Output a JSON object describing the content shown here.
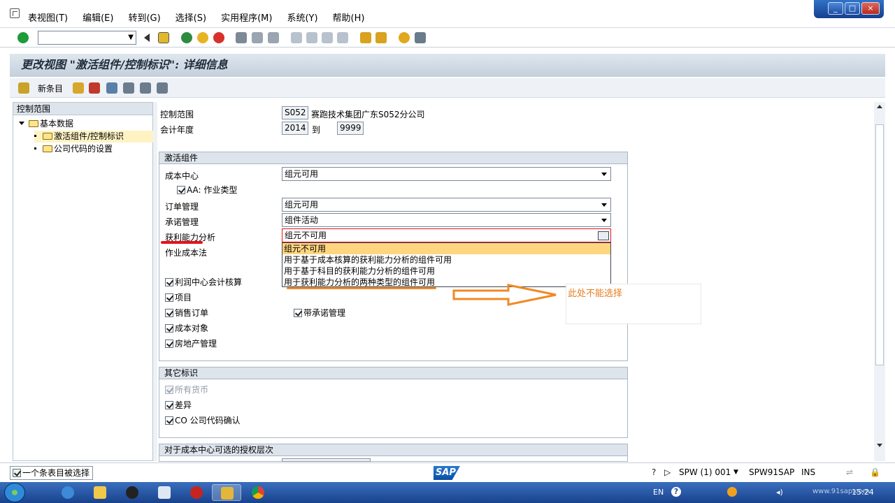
{
  "menu": {
    "items": [
      "表视图(T)",
      "编辑(E)",
      "转到(G)",
      "选择(S)",
      "实用程序(M)",
      "系统(Y)",
      "帮助(H)"
    ]
  },
  "window_buttons": [
    "_",
    "□",
    "×"
  ],
  "title": "更改视图 \"激活组件/控制标识\": 详细信息",
  "appbar": {
    "new_entry": "新条目"
  },
  "tree": {
    "header": "控制范围",
    "root": "基本数据",
    "items": [
      "激活组件/控制标识",
      "公司代码的设置"
    ]
  },
  "header_fields": {
    "controlling_area_label": "控制范围",
    "controlling_area_value": "S052",
    "controlling_area_desc": "赛跑技术集团广东S052分公司",
    "fiscal_year_label": "会计年度",
    "fiscal_year_from": "2014",
    "fiscal_year_to_label": "到",
    "fiscal_year_to": "9999"
  },
  "activate_group": {
    "title": "激活组件",
    "cost_center_label": "成本中心",
    "cost_center_value": "组元可用",
    "aa_activity_label": "AA: 作业类型",
    "order_mgmt_label": "订单管理",
    "order_mgmt_value": "组元可用",
    "commitment_label": "承诺管理",
    "commitment_value": "组件活动",
    "profitability_label": "获利能力分析",
    "profitability_value": "组元不可用",
    "activity_costing_label": "作业成本法",
    "options": [
      "组元不可用",
      "用于基于成本核算的获利能力分析的组件可用",
      "用于基于科目的获利能力分析的组件可用",
      "用于获利能力分析的两种类型的组件可用"
    ],
    "checkboxes": [
      "利润中心会计核算",
      "项目",
      "销售订单",
      "成本对象",
      "房地产管理"
    ],
    "with_commitment": "带承诺管理"
  },
  "other_group": {
    "title": "其它标识",
    "checkboxes": [
      "所有货币",
      "差异",
      "CO 公司代码确认"
    ]
  },
  "auth_group": {
    "title": "对于成本中心可选的授权层次"
  },
  "annotation": {
    "text": "此处不能选择"
  },
  "status": {
    "message": "一个条表目被选择",
    "sap_logo": "SAP",
    "system": "SPW (1) 001",
    "server": "SPW91SAP",
    "mode": "INS"
  },
  "taskbar": {
    "lang": "EN",
    "time": "15:24",
    "watermark": "www.91sap.com"
  },
  "colors": {
    "highlight": "#ffd680",
    "annotation": "#e67e22",
    "red_mark": "#e3141e"
  }
}
